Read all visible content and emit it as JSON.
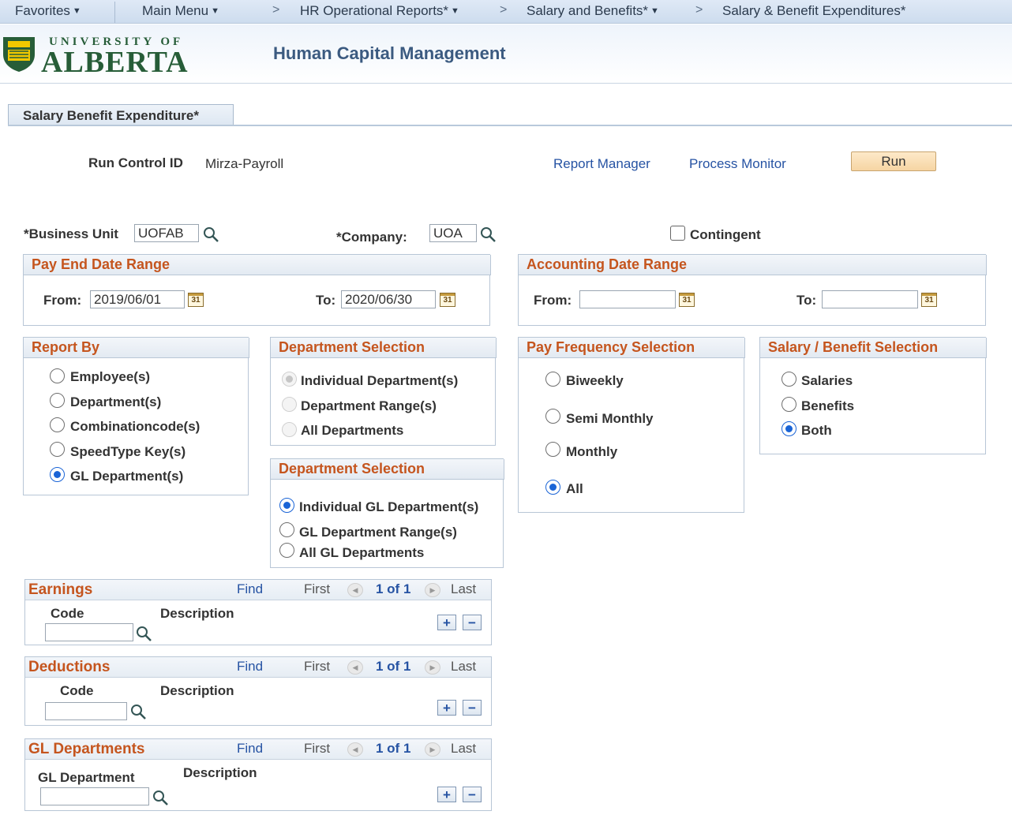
{
  "nav": {
    "favorites": "Favorites",
    "main_menu": "Main Menu",
    "crumbs": [
      "HR Operational Reports*",
      "Salary and Benefits*",
      "Salary & Benefit Expenditures*"
    ],
    "separator": ">"
  },
  "header": {
    "logo_small": "UNIVERSITY OF",
    "logo_big": "ALBERTA",
    "app_title": "Human Capital Management"
  },
  "page": {
    "tab_label": "Salary Benefit Expenditure*",
    "run_control_label": "Run Control ID",
    "run_control_value": "Mirza-Payroll",
    "report_manager": "Report Manager",
    "process_monitor": "Process Monitor",
    "run_label": "Run"
  },
  "criteria": {
    "business_unit_label": "*Business Unit",
    "business_unit_value": "UOFAB",
    "company_label": "*Company:",
    "company_value": "UOA",
    "contingent_label": "Contingent",
    "contingent_checked": false
  },
  "pay_end": {
    "title": "Pay End Date Range",
    "from_label": "From:",
    "from_value": "2019/06/01",
    "to_label": "To:",
    "to_value": "2020/06/30",
    "cal_label": "31"
  },
  "accounting": {
    "title": "Accounting Date Range",
    "from_label": "From:",
    "from_value": "",
    "to_label": "To:",
    "to_value": ""
  },
  "report_by": {
    "title": "Report By",
    "options": [
      "Employee(s)",
      "Department(s)",
      "Combinationcode(s)",
      "SpeedType Key(s)",
      "GL Department(s)"
    ],
    "selected": "GL Department(s)"
  },
  "dept_selection": {
    "title": "Department Selection",
    "options": [
      "Individual Department(s)",
      "Department Range(s)",
      "All Departments"
    ],
    "selected": "Individual Department(s)"
  },
  "gl_dept_selection": {
    "title": "Department Selection",
    "options": [
      "Individual GL Department(s)",
      "GL Department Range(s)",
      "All GL Departments"
    ],
    "selected": "Individual GL Department(s)"
  },
  "pay_frequency": {
    "title": "Pay Frequency Selection",
    "options": [
      "Biweekly",
      "Semi Monthly",
      "Monthly",
      "All"
    ],
    "selected": "All"
  },
  "salary_benefit": {
    "title": "Salary / Benefit Selection",
    "options": [
      "Salaries",
      "Benefits",
      "Both"
    ],
    "selected": "Both"
  },
  "grids": {
    "find": "Find",
    "first": "First",
    "last": "Last",
    "count": "1 of 1",
    "add": "+",
    "remove": "−",
    "earnings": {
      "title": "Earnings",
      "col1": "Code",
      "col2": "Description",
      "code_value": ""
    },
    "deductions": {
      "title": "Deductions",
      "col1": "Code",
      "col2": "Description",
      "code_value": ""
    },
    "gl_departments": {
      "title": "GL Departments",
      "col1": "GL Department",
      "col2": "Description",
      "code_value": ""
    }
  },
  "colors": {
    "section_title": "#c5551e",
    "link": "#2653a3",
    "radio_selected": "#1a64d6",
    "uofa_green": "#275d38"
  }
}
